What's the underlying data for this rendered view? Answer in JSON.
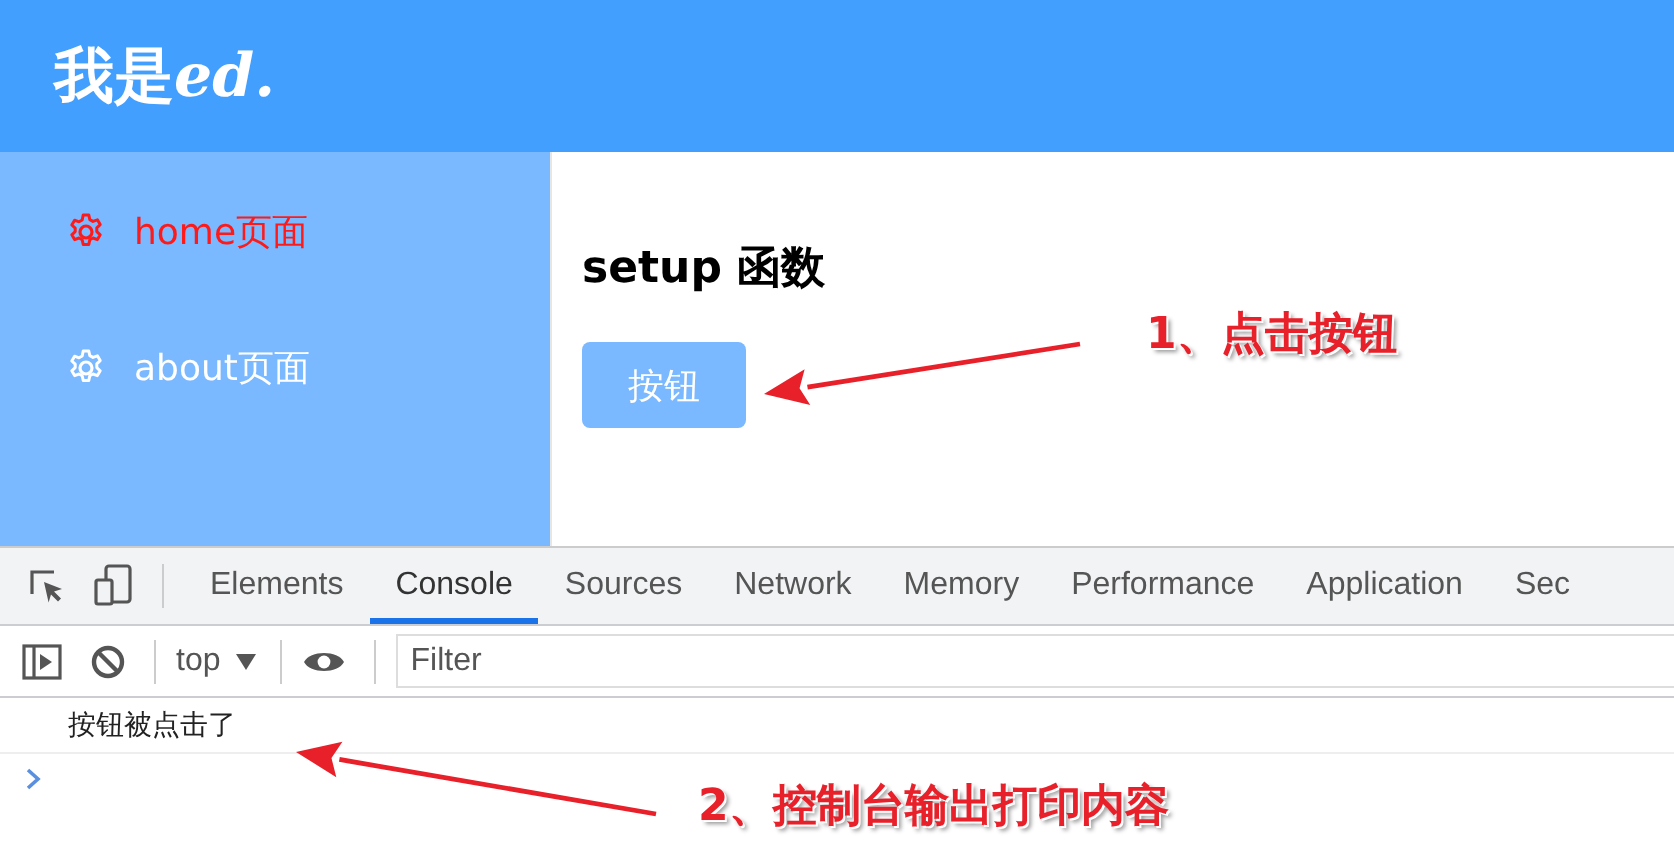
{
  "header": {
    "title": "我是",
    "title_suffix": "ed."
  },
  "sidebar": {
    "items": [
      {
        "label": "home页面",
        "selected": true
      },
      {
        "label": "about页面",
        "selected": false
      }
    ]
  },
  "main": {
    "heading": "setup 函数",
    "button": "按钮"
  },
  "devtools": {
    "tabs": [
      {
        "label": "Elements",
        "selected": false
      },
      {
        "label": "Console",
        "selected": true
      },
      {
        "label": "Sources",
        "selected": false
      },
      {
        "label": "Network",
        "selected": false
      },
      {
        "label": "Memory",
        "selected": false
      },
      {
        "label": "Performance",
        "selected": false
      },
      {
        "label": "Application",
        "selected": false
      },
      {
        "label": "Sec",
        "selected": false
      }
    ],
    "context": "top",
    "filter": {
      "placeholder": "Filter"
    },
    "console": [
      {
        "kind": "log",
        "text": "按钮被点击了"
      },
      {
        "kind": "prompt"
      }
    ]
  },
  "annotations": [
    {
      "text": "1、点击按钮"
    },
    {
      "text": "2、控制台输出打印内容"
    }
  ]
}
